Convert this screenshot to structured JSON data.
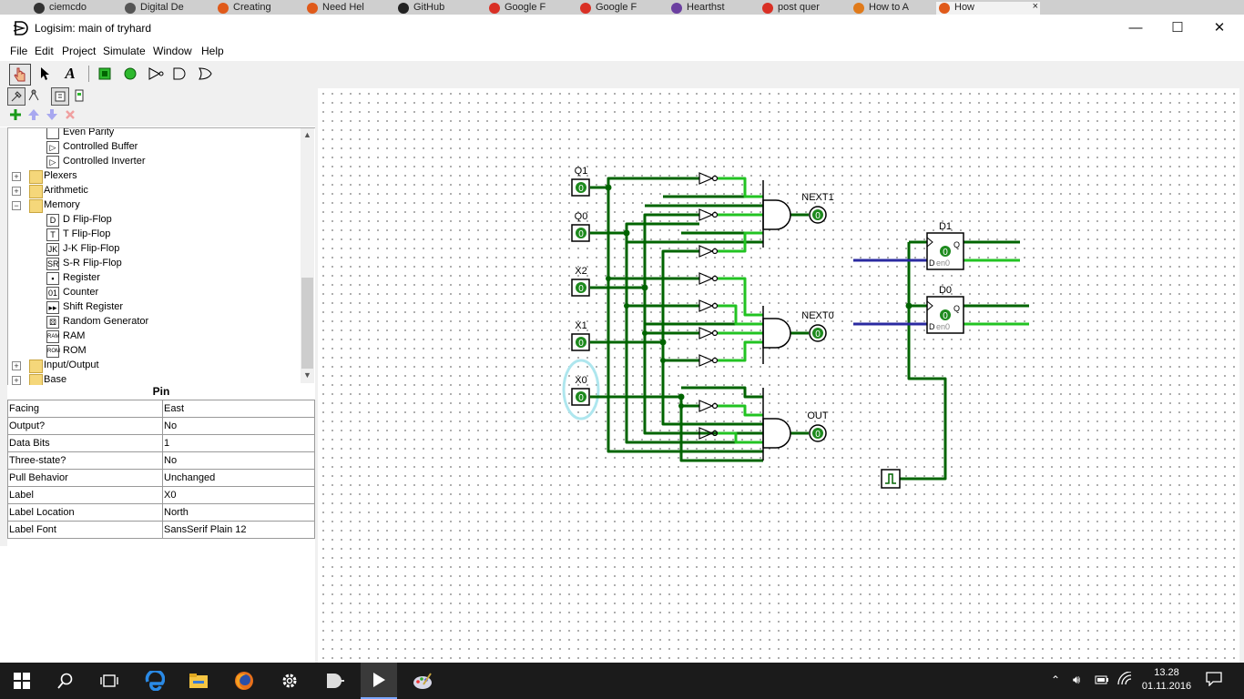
{
  "browser_tabs": [
    {
      "label": "ciemcdo",
      "color": "#333333"
    },
    {
      "label": "Digital De",
      "color": "#555555"
    },
    {
      "label": "Creating",
      "color": "#e05a1a"
    },
    {
      "label": "Need Hel",
      "color": "#e05a1a"
    },
    {
      "label": "GitHub",
      "color": "#222222"
    },
    {
      "label": "Google F",
      "color": "#d93025"
    },
    {
      "label": "Google F",
      "color": "#d93025"
    },
    {
      "label": "Hearthst",
      "color": "#6b3fa0"
    },
    {
      "label": "post quer",
      "color": "#d93025"
    },
    {
      "label": "How to A",
      "color": "#e07a1a"
    },
    {
      "label": "How",
      "color": "#e05a1a"
    }
  ],
  "window": {
    "title": "Logisim: main of tryhard",
    "minimize": "—",
    "maximize": "☐",
    "close": "✕"
  },
  "menu": [
    "File",
    "Edit",
    "Project",
    "Simulate",
    "Window",
    "Help"
  ],
  "tools": {
    "poke": "poke-tool-icon",
    "edit": "edit-tool-icon",
    "text": "A",
    "input_pin": "input-pin-icon",
    "output_pin": "output-pin-icon",
    "not_gate": "not-gate-icon",
    "and_gate": "and-gate-icon",
    "or_gate": "or-gate-icon"
  },
  "explorer": {
    "items": [
      {
        "label": "Even Parity",
        "level": 2,
        "icon": "parity-icon",
        "glyph": ""
      },
      {
        "label": "Controlled Buffer",
        "level": 2,
        "icon": "buffer-icon",
        "glyph": "▷"
      },
      {
        "label": "Controlled Inverter",
        "level": 2,
        "icon": "inverter-icon",
        "glyph": "▷"
      },
      {
        "label": "Plexers",
        "level": 1,
        "icon": "folder-icon",
        "expander": "+"
      },
      {
        "label": "Arithmetic",
        "level": 1,
        "icon": "folder-icon",
        "expander": "+"
      },
      {
        "label": "Memory",
        "level": 1,
        "icon": "folder-icon",
        "expander": "−"
      },
      {
        "label": "D Flip-Flop",
        "level": 2,
        "icon": "d-flipflop-icon",
        "glyph": "D"
      },
      {
        "label": "T Flip-Flop",
        "level": 2,
        "icon": "t-flipflop-icon",
        "glyph": "T"
      },
      {
        "label": "J-K Flip-Flop",
        "level": 2,
        "icon": "jk-flipflop-icon",
        "glyph": "JK"
      },
      {
        "label": "S-R Flip-Flop",
        "level": 2,
        "icon": "sr-flipflop-icon",
        "glyph": "SR"
      },
      {
        "label": "Register",
        "level": 2,
        "icon": "register-icon",
        "glyph": "▪"
      },
      {
        "label": "Counter",
        "level": 2,
        "icon": "counter-icon",
        "glyph": "01"
      },
      {
        "label": "Shift Register",
        "level": 2,
        "icon": "shift-register-icon",
        "glyph": "▸▸"
      },
      {
        "label": "Random Generator",
        "level": 2,
        "icon": "random-generator-icon",
        "glyph": "⚄"
      },
      {
        "label": "RAM",
        "level": 2,
        "icon": "ram-icon",
        "glyph": "RAM"
      },
      {
        "label": "ROM",
        "level": 2,
        "icon": "rom-icon",
        "glyph": "ROM"
      },
      {
        "label": "Input/Output",
        "level": 1,
        "icon": "folder-icon",
        "expander": "+"
      },
      {
        "label": "Base",
        "level": 1,
        "icon": "folder-icon",
        "expander": "+"
      }
    ]
  },
  "attributes": {
    "title": "Pin",
    "rows": [
      {
        "name": "Facing",
        "value": "East"
      },
      {
        "name": "Output?",
        "value": "No"
      },
      {
        "name": "Data Bits",
        "value": "1"
      },
      {
        "name": "Three-state?",
        "value": "No"
      },
      {
        "name": "Pull Behavior",
        "value": "Unchanged"
      },
      {
        "name": "Label",
        "value": "X0"
      },
      {
        "name": "Label Location",
        "value": "North"
      },
      {
        "name": "Label Font",
        "value": "SansSerif Plain 12"
      }
    ]
  },
  "circuit": {
    "inputs": [
      "Q1",
      "Q0",
      "X2",
      "X1",
      "X0"
    ],
    "outputs": [
      "NEXT1",
      "NEXT0",
      "OUT"
    ],
    "flipflops": [
      "D1",
      "D0"
    ],
    "pin_value": "0",
    "ff_q": "Q",
    "ff_d": "D",
    "ff_en": "en0",
    "colors": {
      "wire_low": "#006400",
      "wire_high": "#22c322",
      "bus": "#2a2aa0",
      "selection": "#aee6ee"
    }
  },
  "taskbar": {
    "time": "13.28",
    "date": "01.11.2016"
  }
}
